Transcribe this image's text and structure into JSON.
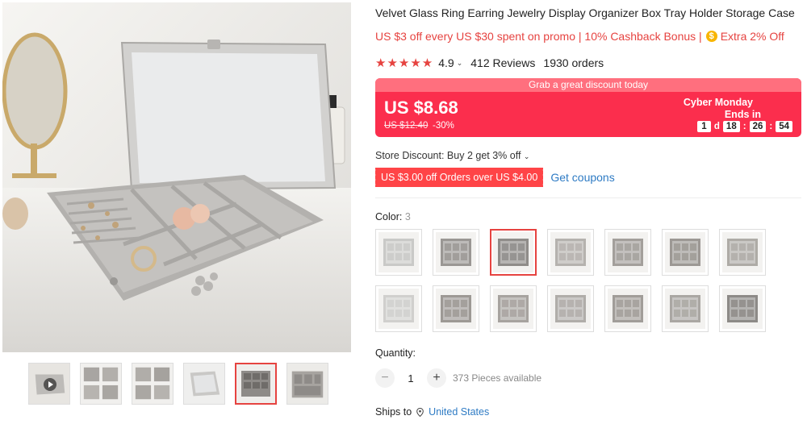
{
  "product": {
    "title": "Velvet Glass Ring Earring Jewelry Display Organizer Box Tray Holder Storage Case"
  },
  "promo": {
    "text": "US $3 off every US $30 spent on promo | 10% Cashback Bonus |",
    "coin_icon": "coin-icon",
    "extra": "Extra 2% Off"
  },
  "rating": {
    "stars": "★★★★★",
    "value": "4.9",
    "reviews": "412 Reviews",
    "orders": "1930 orders"
  },
  "banner": {
    "headline": "Grab a great discount today",
    "price": "US $8.68",
    "old_price": "US $12.40",
    "discount": "-30%",
    "event": "Cyber Monday",
    "ends_in": "Ends in",
    "countdown": {
      "days": "1",
      "days_unit": "d",
      "hours": "18",
      "minutes": "26",
      "seconds": "54",
      "separator": ":"
    },
    "colors": {
      "main": "#fb2e4d",
      "top": "#ff6f7e"
    }
  },
  "store_discount": "Store Discount: Buy 2 get 3% off",
  "coupon": {
    "tag": "US $3.00 off Orders over US $4.00",
    "link": "Get coupons"
  },
  "color": {
    "label": "Color:",
    "selected": "3",
    "options": [
      {
        "tone": "#c9c9c7",
        "active": false
      },
      {
        "tone": "#9a9794",
        "active": false
      },
      {
        "tone": "#8f8c89",
        "active": true
      },
      {
        "tone": "#b5b2ae",
        "active": false
      },
      {
        "tone": "#a39f9b",
        "active": false
      },
      {
        "tone": "#9c9894",
        "active": false
      },
      {
        "tone": "#aeaba6",
        "active": false
      },
      {
        "tone": "#d0cfcd",
        "active": false
      },
      {
        "tone": "#9d9995",
        "active": false
      },
      {
        "tone": "#a7a39f",
        "active": false
      },
      {
        "tone": "#b0ada9",
        "active": false
      },
      {
        "tone": "#a19d99",
        "active": false
      },
      {
        "tone": "#aaa7a3",
        "active": false
      },
      {
        "tone": "#8d8a87",
        "active": false
      }
    ]
  },
  "quantity": {
    "label": "Quantity:",
    "minus": "−",
    "value": "1",
    "plus": "+",
    "available": "373 Pieces available"
  },
  "shipping": {
    "label": "Ships to",
    "country": "United States"
  },
  "accent": "#e64340",
  "link_color": "#2e7bc4"
}
